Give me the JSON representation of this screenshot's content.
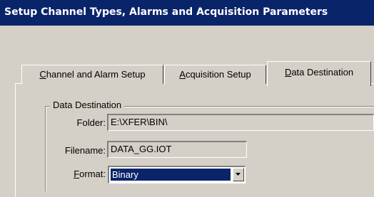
{
  "window": {
    "title": "Setup Channel Types, Alarms and Acquisition Parameters"
  },
  "tabs": [
    {
      "label": "Channel and Alarm Setup",
      "accel": "C",
      "rest": "hannel and Alarm Setup",
      "active": false
    },
    {
      "label": "Acquisition Setup",
      "accel": "A",
      "rest": "cquisition Setup",
      "active": false
    },
    {
      "label": "Data Destination",
      "accel": "D",
      "rest": "ata Destination",
      "active": true
    }
  ],
  "group": {
    "title": "Data Destination"
  },
  "folder": {
    "label": "Folder:",
    "value": "E:\\XFER\\BIN\\"
  },
  "filename": {
    "label": "Filename:",
    "value": "DATA_GG.IOT"
  },
  "format": {
    "label": "Format:",
    "accel": "F",
    "rest": "ormat:",
    "value": "Binary"
  },
  "icons": {
    "dropdown": "chevron-down-icon"
  },
  "colors": {
    "titlebar": "#0a246a",
    "face": "#d4d0c8",
    "selection": "#0a246a"
  }
}
